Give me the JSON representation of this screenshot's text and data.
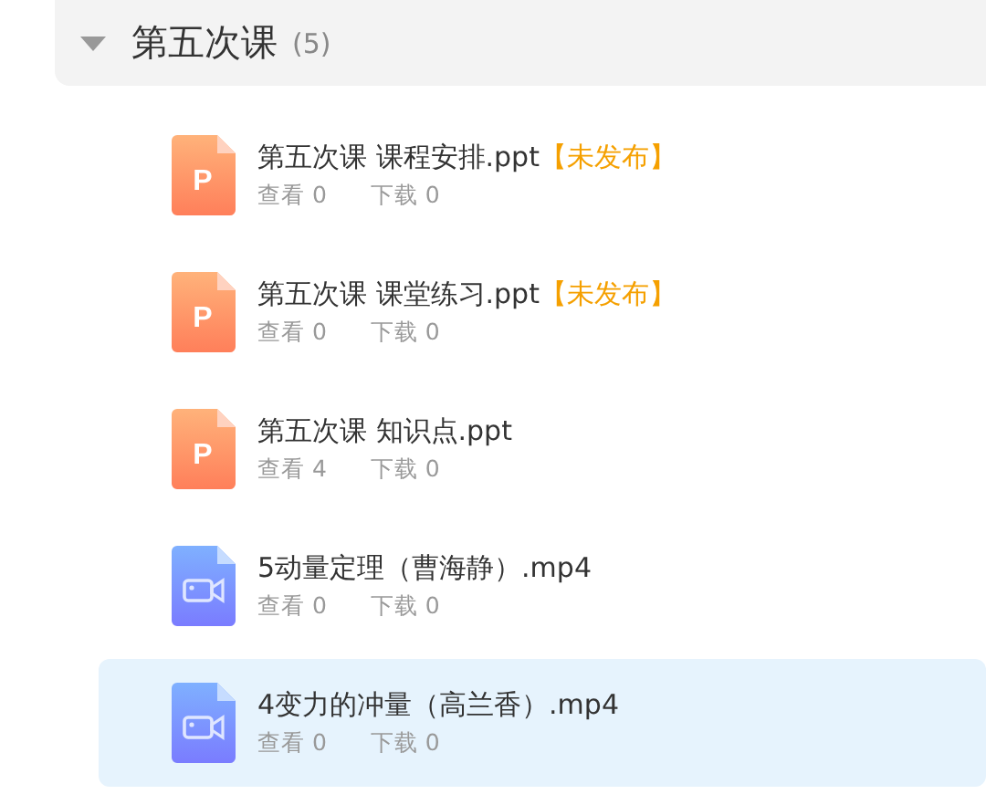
{
  "section": {
    "title": "第五次课",
    "count": "(5)",
    "expanded": true
  },
  "files": [
    {
      "kind": "ppt",
      "icon_letter": "P",
      "name": "第五次课 课程安排.ppt",
      "status": "【未发布】",
      "views": "查看 0",
      "downloads": "下载 0",
      "selected": false
    },
    {
      "kind": "ppt",
      "icon_letter": "P",
      "name": "第五次课 课堂练习.ppt",
      "status": "【未发布】",
      "views": "查看 0",
      "downloads": "下载 0",
      "selected": false
    },
    {
      "kind": "ppt",
      "icon_letter": "P",
      "name": "第五次课 知识点.ppt",
      "views": "查看 4",
      "downloads": "下载 0",
      "selected": false
    },
    {
      "kind": "video",
      "name": "5动量定理（曹海静）.mp4",
      "views": "查看 0",
      "downloads": "下载 0",
      "selected": false
    },
    {
      "kind": "video",
      "name": "4变力的冲量（高兰香）.mp4",
      "views": "查看 0",
      "downloads": "下载 0",
      "selected": true
    }
  ]
}
